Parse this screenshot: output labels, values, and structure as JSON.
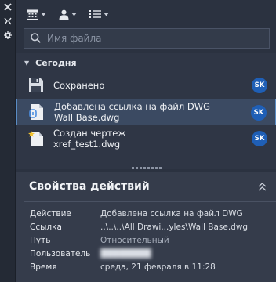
{
  "search": {
    "placeholder": "Имя файла"
  },
  "group": {
    "label": "Сегодня"
  },
  "items": [
    {
      "icon": "save-disk-icon",
      "lines": [
        "Сохранено"
      ],
      "user": "SK"
    },
    {
      "icon": "xref-attach-icon",
      "lines": [
        "Добавлена ссылка на файл DWG",
        "Wall Base.dwg"
      ],
      "user": "SK",
      "selected": true
    },
    {
      "icon": "new-drawing-icon",
      "lines": [
        "Создан чертеж",
        "xref_test1.dwg"
      ],
      "user": "SK"
    }
  ],
  "properties": {
    "title": "Свойства действий",
    "rows": [
      {
        "label": "Действие",
        "value": "Добавлена ссылка на файл DWG"
      },
      {
        "label": "Ссылка",
        "value": "..\\..\\..\\All Drawi...yles\\Wall Base.dwg"
      },
      {
        "label": "Путь",
        "value": "Относительный"
      },
      {
        "label": "Пользователь",
        "value": ""
      },
      {
        "label": "Время",
        "value": "среда, 21 февраля в 11:28"
      }
    ]
  },
  "colors": {
    "background": "#2b3240",
    "avatar": "#1f5fb6",
    "selection": "#3b4a62"
  }
}
